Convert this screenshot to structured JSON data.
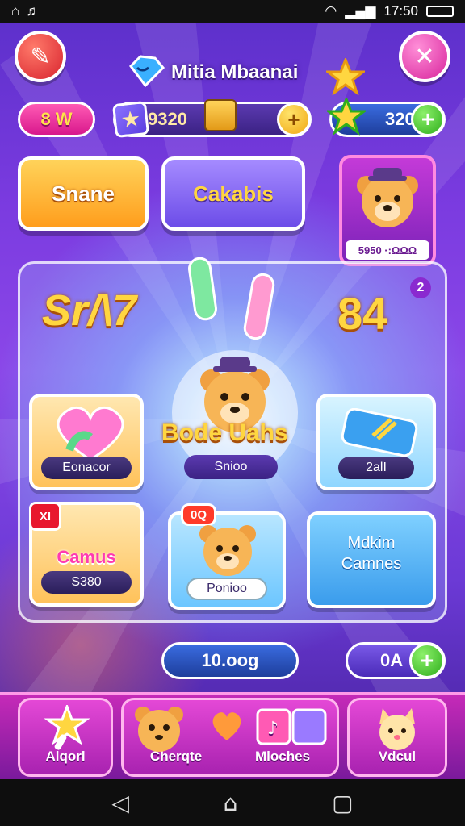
{
  "status_bar": {
    "time": "17:50"
  },
  "header": {
    "title": "Mitia Mbaanai"
  },
  "currency": {
    "level": "8 W",
    "coins": "9320",
    "gems": "320"
  },
  "modes": {
    "share_label": "Snane",
    "cakabis_label": "Cakabis"
  },
  "profile": {
    "label": "5950 ·:ΩΩΩ"
  },
  "board": {
    "score_left": "Sr/\\7",
    "score_right": "84",
    "score_right_badge": "2",
    "hub_title": "Bode Uahs",
    "hub_caption": "Snioo",
    "tiles": {
      "heart_caption": "Eonacor",
      "box_caption": "2alI",
      "games_title": "Camus",
      "games_caption": "S380",
      "games_badge": "XI",
      "bear_caption": "Ponioo",
      "bear_badge": "0Q",
      "mini_title_line1": "Mdkim",
      "mini_title_line2": "Camnes"
    }
  },
  "footer": {
    "total": "10.oog",
    "timer": "0A"
  },
  "nav": {
    "achieve_label": "Alqorl",
    "center_left_label": "Cherqte",
    "center_right_label": "Mloches",
    "music_label": "Vdcul"
  },
  "colors": {
    "accent": "#ffd640",
    "primary": "#7b3be0",
    "nav": "#c62ab8"
  },
  "icons": {
    "back": "back-arrow-icon",
    "close": "close-icon",
    "gem": "gem-icon",
    "star": "star-icon",
    "plus": "plus-icon"
  }
}
